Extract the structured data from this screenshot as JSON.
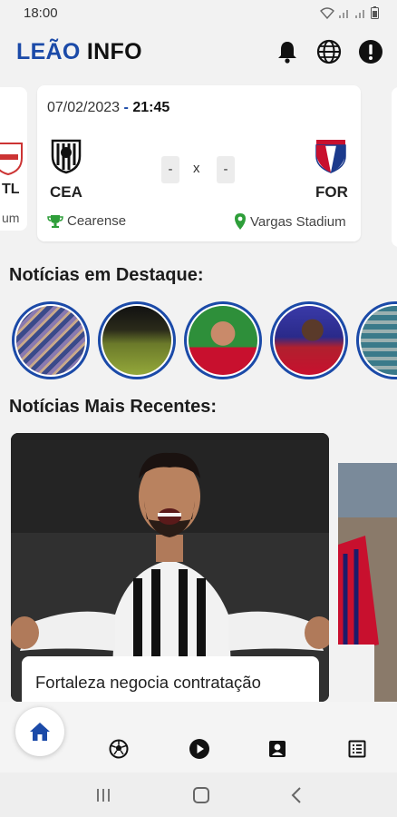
{
  "status_bar": {
    "time": "18:00"
  },
  "app": {
    "title_part1": "LEÃO",
    "title_part2": "INFO"
  },
  "peek_card": {
    "code": "TL",
    "meta": "um"
  },
  "match": {
    "date": "07/02/2023",
    "separator": "-",
    "time": "21:45",
    "home_code": "CEA",
    "away_code": "FOR",
    "home_score": "-",
    "away_score": "-",
    "versus": "x",
    "competition": "Cearense",
    "stadium": "Vargas Stadium"
  },
  "featured": {
    "title": "Notícias em Destaque:"
  },
  "recent": {
    "title": "Notícias Mais Recentes:",
    "headline": "Fortaleza negocia contratação"
  },
  "colors": {
    "brand_blue": "#1b4aa8",
    "green": "#2e9e3a"
  },
  "icons": [
    "bell-icon",
    "globe-icon",
    "info-icon",
    "home-icon",
    "soccer-ball-icon",
    "play-icon",
    "player-card-icon",
    "table-icon"
  ]
}
